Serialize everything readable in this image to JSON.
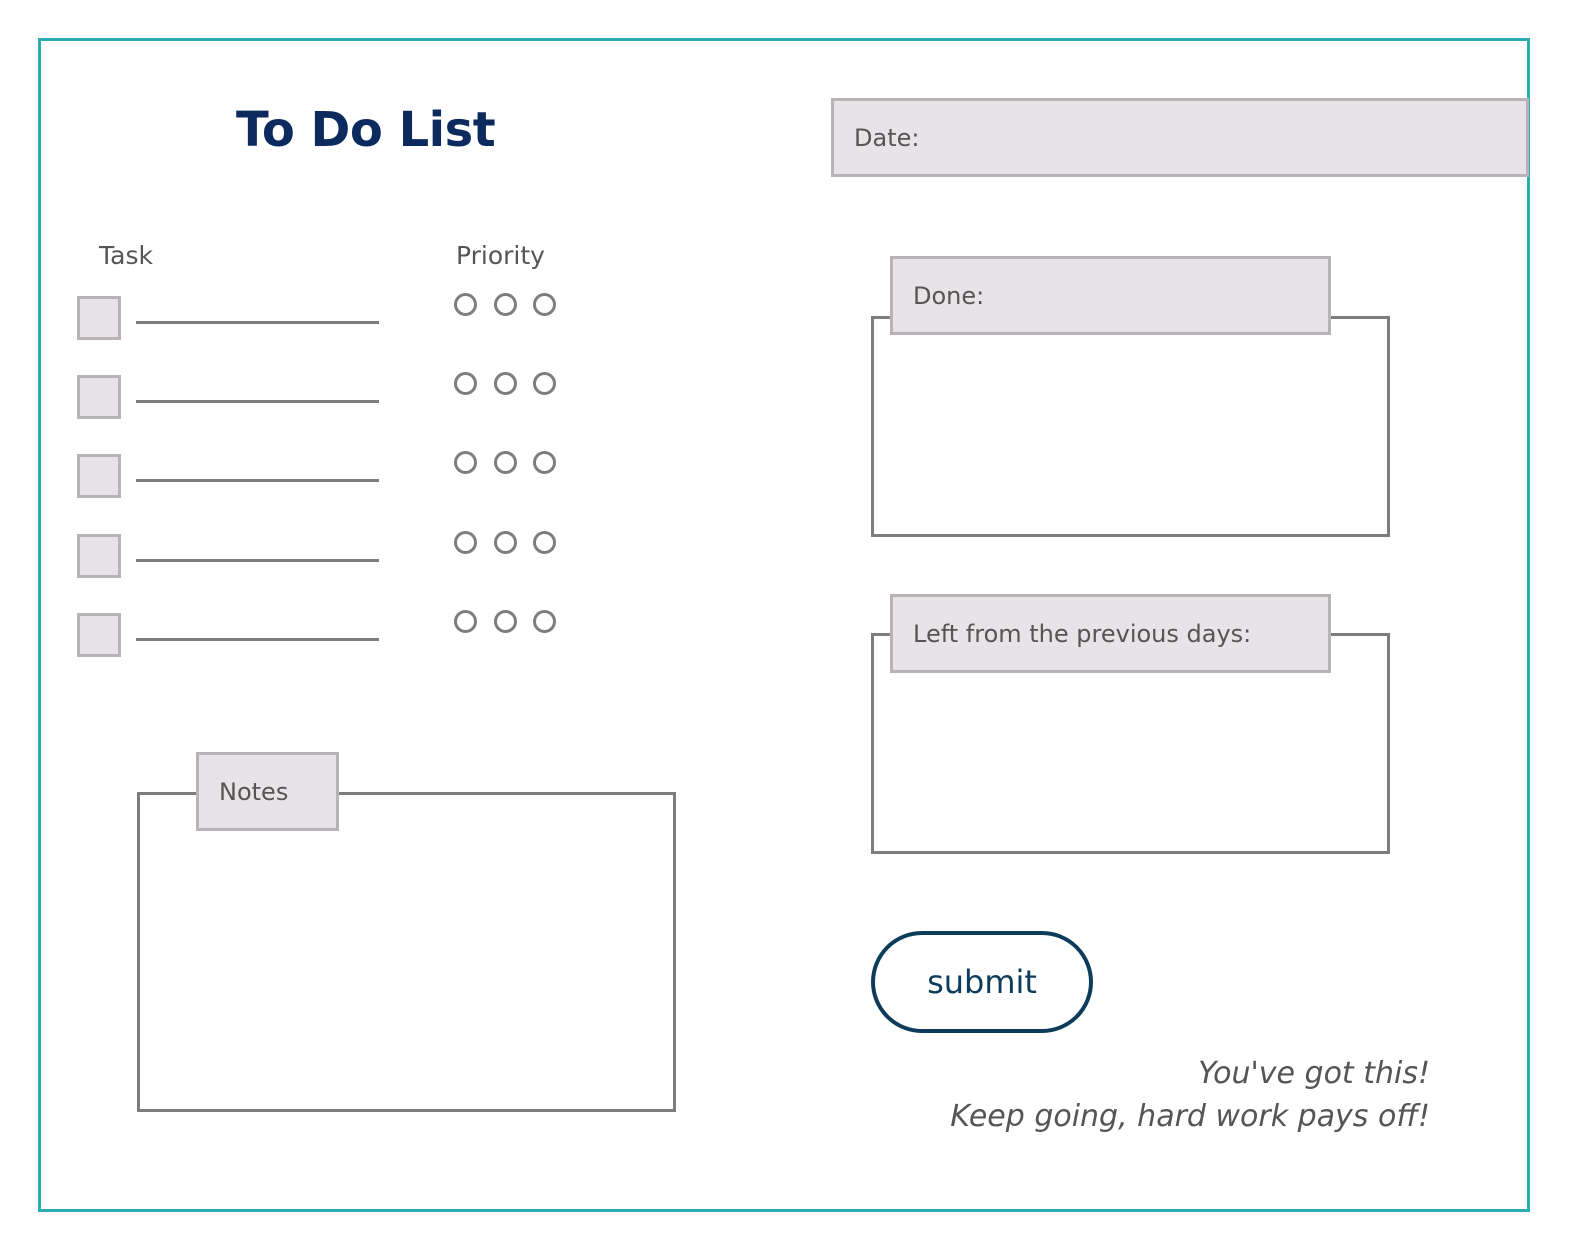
{
  "header": {
    "title": "To Do List",
    "date_label": "Date:"
  },
  "tasks": {
    "column_task": "Task",
    "column_priority": "Priority",
    "rows": [
      {
        "checked": false,
        "priority": null
      },
      {
        "checked": false,
        "priority": null
      },
      {
        "checked": false,
        "priority": null
      },
      {
        "checked": false,
        "priority": null
      },
      {
        "checked": false,
        "priority": null
      }
    ]
  },
  "notes": {
    "label": "Notes"
  },
  "done": {
    "label": "Done:"
  },
  "left_over": {
    "label": "Left from the previous days:"
  },
  "actions": {
    "submit_label": "submit"
  },
  "motto": {
    "line1": "You've got this!",
    "line2": "Keep going, hard work pays off!"
  },
  "colors": {
    "frame": "#2aadb0",
    "title": "#0c2a5e",
    "submit": "#0d3c5a",
    "box_fill": "#e7e3e7",
    "box_border": "#b7b3b7",
    "line": "#7d7d7d"
  }
}
